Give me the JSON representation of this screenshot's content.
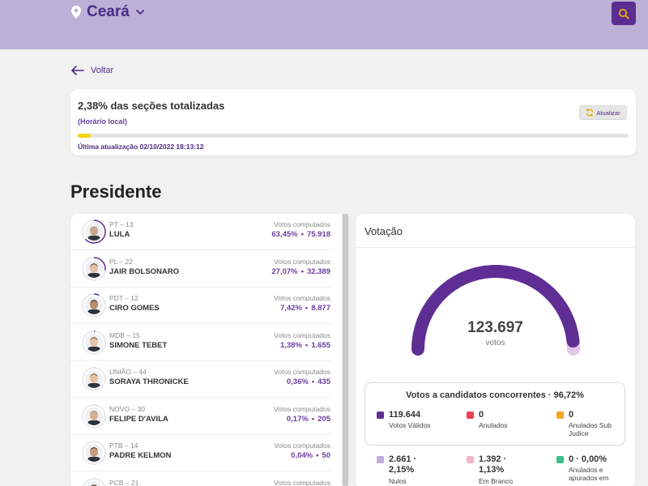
{
  "header": {
    "location": "Ceará",
    "icons": {
      "location": "map-pin-icon",
      "dropdown": "chevron-down-icon",
      "search": "search-icon"
    },
    "colors": {
      "bar": "#bcb0d6",
      "accent": "#5a2d91",
      "search_icon": "#f2a900"
    }
  },
  "nav": {
    "back_label": "Voltar"
  },
  "status": {
    "title": "2,38% das seções totalizadas",
    "local_time_label": "(Horário local)",
    "progress_percent": 2.38,
    "last_update": "Última atualização 02/10/2022 18:13:12",
    "refresh_label": "Atualizar"
  },
  "section_title": "Presidente",
  "candidates": [
    {
      "party": "PT – 13",
      "name": "LULA",
      "votes_label": "Votos computados",
      "percent": "63,45%",
      "votes": "75.918"
    },
    {
      "party": "PL – 22",
      "name": "JAIR BOLSONARO",
      "votes_label": "Votos computados",
      "percent": "27,07%",
      "votes": "32.389"
    },
    {
      "party": "PDT – 12",
      "name": "CIRO GOMES",
      "votes_label": "Votos computados",
      "percent": "7,42%",
      "votes": "8.877"
    },
    {
      "party": "MDB – 15",
      "name": "SIMONE TEBET",
      "votes_label": "Votos computados",
      "percent": "1,38%",
      "votes": "1.655"
    },
    {
      "party": "UNIÃO – 44",
      "name": "SORAYA THRONICKE",
      "votes_label": "Votos computados",
      "percent": "0,36%",
      "votes": "435"
    },
    {
      "party": "NOVO – 30",
      "name": "FELIPE D'AVILA",
      "votes_label": "Votos computados",
      "percent": "0,17%",
      "votes": "205"
    },
    {
      "party": "PTB – 14",
      "name": "PADRE KELMON",
      "votes_label": "Votos computados",
      "percent": "0,04%",
      "votes": "50"
    },
    {
      "party": "PCB – 21",
      "name": "",
      "votes_label": "Votos computados",
      "percent": "",
      "votes": ""
    }
  ],
  "votacao": {
    "title": "Votação",
    "total": "123.697",
    "total_label": "votos",
    "gauge": {
      "valid_fraction": 0.9672,
      "other_fraction": 0.0328,
      "valid_color": "#5f2e94",
      "other_color": "#e3c6e8"
    },
    "concorrentes": {
      "title": "Votos a candidatos concorrentes · 96,72%",
      "items": [
        {
          "value": "119.644",
          "label": "Votos Válidos",
          "color": "#5f2e94"
        },
        {
          "value": "0",
          "label": "Anulados",
          "color": "#ec4158"
        },
        {
          "value": "0",
          "label": "Anulados Sub Judice",
          "color": "#f5a623"
        }
      ]
    },
    "outros": [
      {
        "value": "2.661 · 2,15%",
        "label": "Nulos",
        "color": "#c2aad9"
      },
      {
        "value": "1.392 · 1,13%",
        "label": "Em Branco",
        "color": "#f3b6c4"
      },
      {
        "value": "0 · 0,00%",
        "label": "Anulados e apurados em",
        "color": "#3fbf8a"
      }
    ]
  }
}
